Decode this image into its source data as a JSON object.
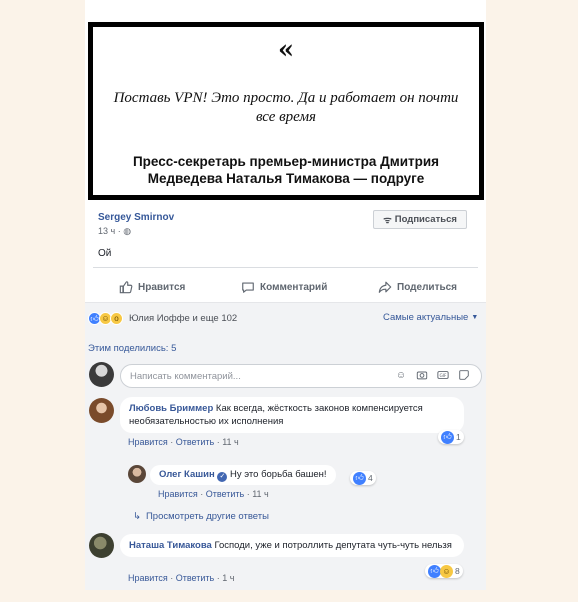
{
  "quote": {
    "mark": "«",
    "text": "Поставь VPN! Это просто. Да и работает он почти все время",
    "author": "Пресс-секретарь премьер-министра Дмитрия Медведева Наталья Тимакова — подруге"
  },
  "post": {
    "author": "Sergey Smirnov",
    "time": "13 ч",
    "text": "Ой",
    "subscribe_label": "Подписаться"
  },
  "actions": {
    "like": "Нравится",
    "comment": "Комментарий",
    "share": "Поделиться"
  },
  "reactions": {
    "summary": "Юлия Иоффе и еще 102",
    "sort": "Самые актуальные"
  },
  "shared": "Этим поделились: 5",
  "comment_input": {
    "placeholder": "Написать комментарий..."
  },
  "comments": [
    {
      "author": "Любовь Бриммер",
      "text": "Как всегда, жёсткость законов компенсируется необязательностью их исполнения",
      "like": "Нравится",
      "reply": "Ответить",
      "time": "11 ч",
      "reactions": "1"
    },
    {
      "author": "Олег Кашин",
      "text": "Ну это борьба башен!",
      "like": "Нравится",
      "reply": "Ответить",
      "time": "11 ч",
      "reactions": "4"
    },
    {
      "author": "Наташа Тимакова",
      "text": "Господи, уже и потроллить депутата чуть-чуть нельзя",
      "like": "Нравится",
      "reply": "Ответить",
      "time": "1 ч",
      "reactions": "8"
    }
  ],
  "more_replies": "Просмотреть другие ответы",
  "colors": {
    "link": "#365899",
    "like_blue": "#4080ff",
    "page_bg": "#fbf3e9"
  }
}
